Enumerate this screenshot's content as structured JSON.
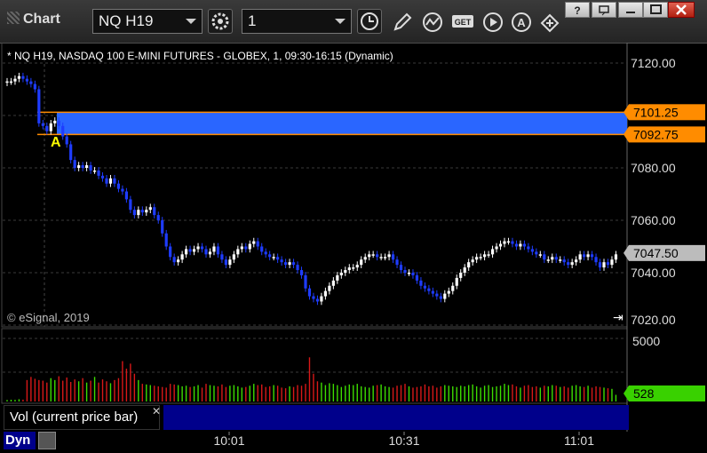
{
  "window": {
    "title": "Chart"
  },
  "toolbar": {
    "symbol": "NQ H19",
    "interval": "1"
  },
  "chart": {
    "header": "* NQ H19, NASDAQ 100 E-MINI FUTURES - GLOBEX, 1, 09:30-16:15 (Dynamic)",
    "copyright": "© eSignal, 2019",
    "price_labels": [
      "7120.00",
      "7080.00",
      "7060.00",
      "7040.00",
      "7020.00"
    ],
    "tag_top": "7101.25",
    "tag_bottom": "7092.75",
    "tag_last": "7047.50",
    "annotation": "A",
    "vol_labels": [
      "5000"
    ],
    "vol_last": "528",
    "time_labels": [
      "10:01",
      "10:31",
      "11:01"
    ],
    "vol_panel_title": "Vol (current price bar)",
    "page_label": "Dyn",
    "colors": {
      "up": "#ffffff",
      "down": "#1e3cff",
      "zone": "#2a66ff",
      "zone_line": "#ff8c00",
      "vol_up": "#3ddc00",
      "vol_down": "#d81818",
      "tag_last": "#bcbcbc",
      "tag_vol": "#39d100"
    }
  },
  "chart_data": {
    "type": "candlestick",
    "ylim": [
      7020,
      7125
    ],
    "zone": [
      7092.75,
      7101.25
    ],
    "close_series": [
      7113,
      7113,
      7114,
      7115,
      7114,
      7113,
      7112,
      7110,
      7097,
      7096,
      7094,
      7097,
      7098,
      7096,
      7092,
      7089,
      7083,
      7080,
      7081,
      7080,
      7081,
      7079,
      7079,
      7077,
      7076,
      7074,
      7076,
      7074,
      7072,
      7071,
      7068,
      7064,
      7062,
      7064,
      7063,
      7064,
      7065,
      7062,
      7060,
      7055,
      7050,
      7046,
      7044,
      7045,
      7047,
      7049,
      7048,
      7049,
      7050,
      7049,
      7047,
      7048,
      7050,
      7047,
      7045,
      7043,
      7045,
      7047,
      7049,
      7050,
      7049,
      7051,
      7052,
      7050,
      7048,
      7047,
      7046,
      7046,
      7045,
      7044,
      7043,
      7044,
      7043,
      7041,
      7039,
      7034,
      7031,
      7030,
      7029,
      7031,
      7033,
      7035,
      7037,
      7039,
      7040,
      7041,
      7042,
      7042,
      7043,
      7045,
      7046,
      7047,
      7047,
      7046,
      7046,
      7046,
      7047,
      7045,
      7043,
      7041,
      7040,
      7040,
      7039,
      7037,
      7035,
      7034,
      7033,
      7032,
      7031,
      7030,
      7032,
      7033,
      7035,
      7038,
      7040,
      7042,
      7044,
      7045,
      7046,
      7046,
      7047,
      7047,
      7049,
      7050,
      7051,
      7052,
      7052,
      7051,
      7050,
      7051,
      7050,
      7049,
      7048,
      7047,
      7047,
      7045,
      7045,
      7046,
      7045,
      7045,
      7044,
      7043,
      7044,
      7045,
      7047,
      7046,
      7047,
      7046,
      7044,
      7042,
      7044,
      7043,
      7045,
      7047
    ],
    "volume_series": [
      120,
      140,
      130,
      180,
      150,
      1700,
      1950,
      1800,
      1700,
      1650,
      1500,
      1850,
      1700,
      2000,
      1650,
      1900,
      1550,
      1750,
      1600,
      1850,
      1500,
      1650,
      1950,
      1500,
      1750,
      1600,
      1450,
      1700,
      1850,
      3200,
      2600,
      3000,
      2200,
      1700,
      1400,
      1350,
      1300,
      1250,
      1200,
      1150,
      1100,
      1400,
      1350,
      1300,
      1200,
      1250,
      1150,
      1200,
      1300,
      1100,
      1400,
      1300,
      1250,
      1200,
      1350,
      1150,
      1250,
      1300,
      1200,
      1100,
      1150,
      1250,
      1400,
      1300,
      1350,
      1150,
      1200,
      1300,
      1250,
      1100,
      1050,
      1200,
      1150,
      1300,
      1250,
      1400,
      3500,
      2200,
      1600,
      1500,
      1300,
      1450,
      1400,
      1300,
      1150,
      1250,
      1350,
      1300,
      1400,
      1200,
      1150,
      1100,
      1250,
      1300,
      1350,
      1200,
      1150,
      1100,
      1250,
      1300,
      1400,
      1200,
      1100,
      1150,
      1200,
      1350,
      1200,
      1250,
      1100,
      1200,
      1300,
      1250,
      1200,
      1150,
      1250,
      1200,
      1300,
      1350,
      1200,
      1100,
      1250,
      1300,
      1150,
      1200,
      1250,
      1400,
      1300,
      1350,
      1200,
      1100,
      1250,
      1300,
      1150,
      1200,
      1100,
      1250,
      1200,
      1300,
      1250,
      1150,
      1200,
      1100,
      1250,
      1300,
      1200,
      1150,
      1250,
      1100,
      1200,
      1150,
      1100,
      1050,
      1000,
      528
    ]
  }
}
